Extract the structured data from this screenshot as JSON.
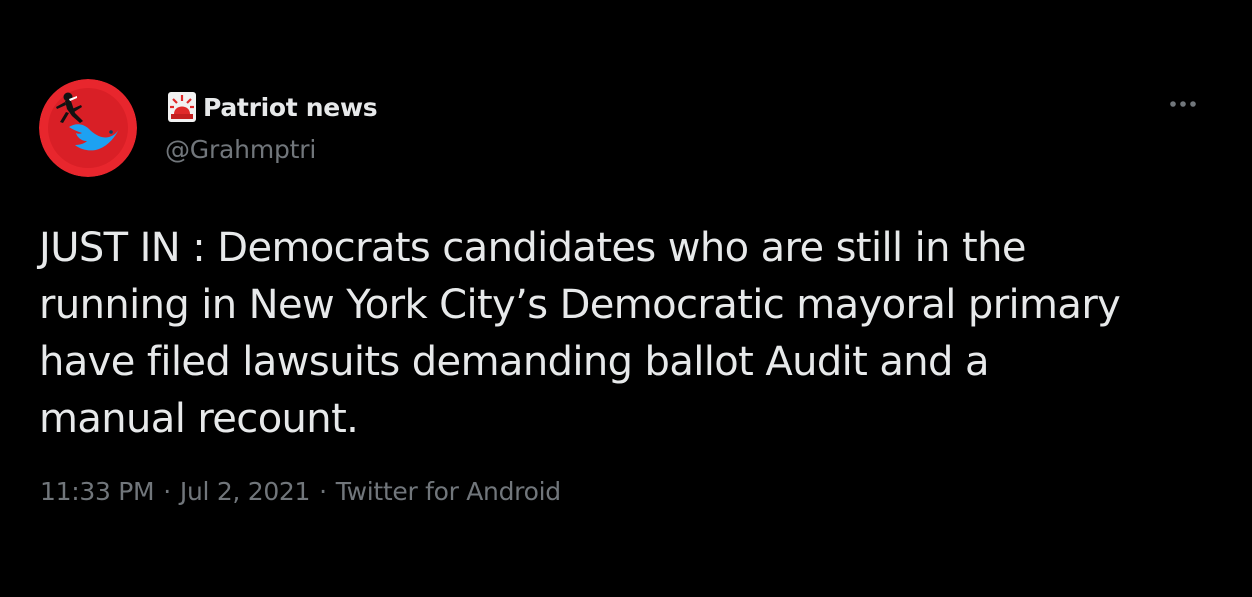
{
  "tweet": {
    "author": {
      "display_name": "Patriot news",
      "badge_icon": "police-siren-emoji",
      "handle": "@Grahmptri",
      "avatar": "red-circle-blue-bird-avatar"
    },
    "menu_icon": "more-horizontal-icon",
    "text": "JUST IN : Democrats candidates who are still in the\nrunning in New York City’s Democratic mayoral primary\nhave filed lawsuits demanding ballot Audit and a\nmanual recount.",
    "time": "11:33 PM",
    "date": "Jul 2, 2021",
    "separator": "·",
    "source": "Twitter for Android"
  },
  "colors": {
    "background": "#000000",
    "primary_text": "#e7e9ea",
    "secondary_text": "#71767b",
    "avatar_red": "#e8262d",
    "bird_blue": "#1da1f2"
  }
}
